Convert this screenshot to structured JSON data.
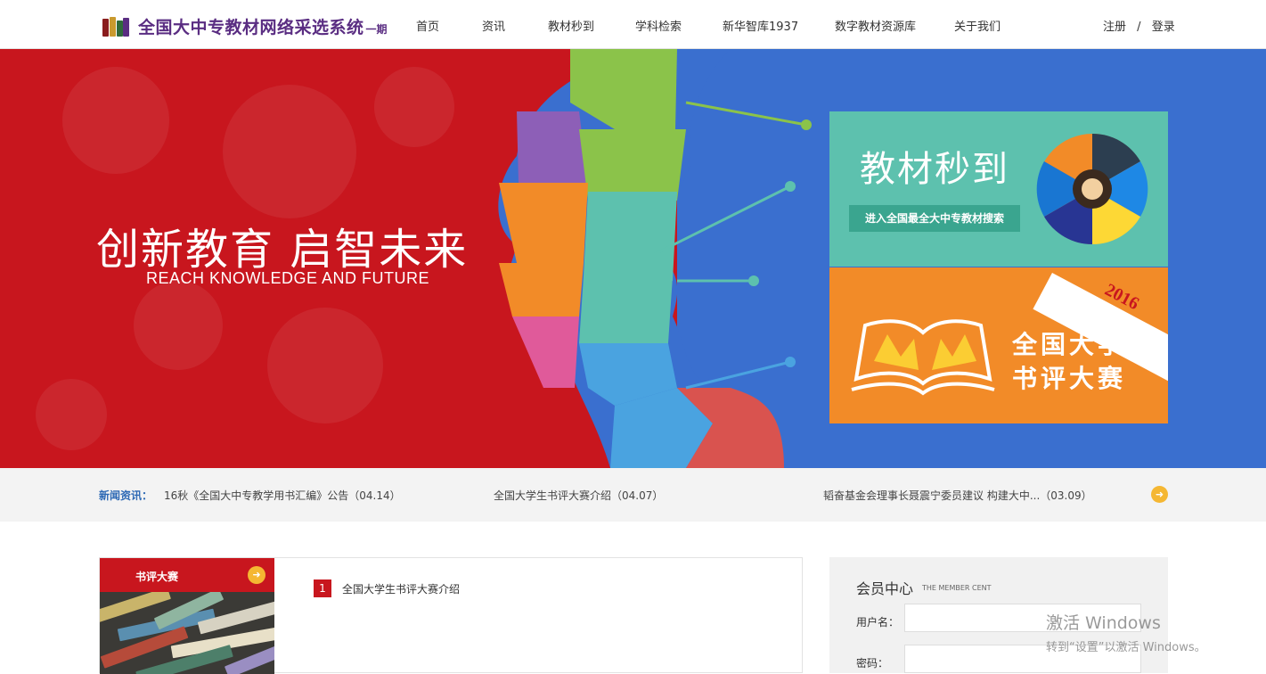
{
  "header": {
    "logo_title": "全国大中专教材网络采选系统",
    "logo_sub": "一期",
    "nav": [
      "首页",
      "资讯",
      "教材秒到",
      "学科检索",
      "新华智库1937",
      "数字教材资源库",
      "关于我们"
    ],
    "register": "注册",
    "separator": "/",
    "login": "登录"
  },
  "banner": {
    "slogan": "创新教育 启智未来",
    "slogan_en": "REACH KNOWLEDGE AND FUTURE",
    "teal_card": {
      "title": "教材秒到",
      "button": "进入全国最全大中专教材搜索"
    },
    "orange_card": {
      "year": "2016",
      "title_line1": "全国大学生",
      "title_line2": "书评大赛"
    }
  },
  "news": {
    "label": "新闻资讯：",
    "items": [
      "16秋《全国大中专教学用书汇编》公告（04.14）",
      "全国大学生书评大赛介绍（04.07）",
      "韬奋基金会理事长聂震宁委员建议 构建大中...（03.09）"
    ],
    "next_icon": "arrow-right-icon"
  },
  "review": {
    "title": "书评大赛",
    "list": [
      {
        "num": "1",
        "text": "全国大学生书评大赛介绍"
      }
    ]
  },
  "member": {
    "title": "会员中心",
    "subtitle": "THE MEMBER CENT",
    "username_label": "用户名：",
    "password_label": "密码："
  },
  "watermark": {
    "line1": "激活 Windows",
    "line2": "转到“设置”以激活 Windows。"
  }
}
